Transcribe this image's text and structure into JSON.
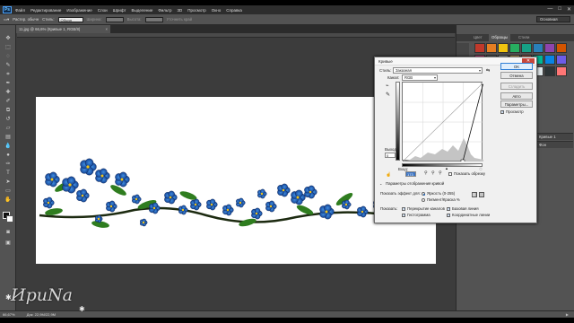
{
  "app": {
    "logo": "Ps",
    "menu": [
      "Файл",
      "Редактирование",
      "Изображение",
      "Слои",
      "Шрифт",
      "Выделение",
      "Фильтр",
      "3D",
      "Просмотр",
      "Окно",
      "Справка"
    ],
    "window_controls": [
      "—",
      "□",
      "✕"
    ]
  },
  "options": {
    "tool_label": "Растер. обычн",
    "mode_label": "Стиль:",
    "mode_value": "Обычн",
    "width_label": "Ширина:",
    "height_label": "Высота:",
    "refine": "Уточнить край",
    "workspace": "Основная"
  },
  "document": {
    "tab_title": "11.jpg @ 66,6% (Кривые 1, RGB/8)",
    "close": "×"
  },
  "status": {
    "zoom": "66,67%",
    "info": "Док: 22,9M/22,9M",
    "right": "▶"
  },
  "panels": {
    "tabs": [
      "Цвет",
      "Образцы",
      "Стили"
    ],
    "active_tab": 1,
    "layers": [
      "Кривые 1",
      "Фон"
    ],
    "swatch_colors": [
      "#c0392b",
      "#e67e22",
      "#f1c40f",
      "#27ae60",
      "#16a085",
      "#2980b9",
      "#8e44ad",
      "#d35400",
      "#e84393",
      "#636e72",
      "#b2bec3",
      "#fdcb6e",
      "#e17055",
      "#00b894",
      "#0984e3",
      "#6c5ce7",
      "#fab1a0",
      "#74b9ff",
      "#a29bfe",
      "#55efc4",
      "#ffeaa7",
      "#dfe6e9",
      "#2d3436",
      "#ff7675"
    ]
  },
  "curves": {
    "title": "Кривые",
    "close": "✕",
    "preset_label": "Стиль:",
    "preset_value": "Заказная",
    "channel_label": "Канал:",
    "channel_value": "RGB",
    "output_label": "Выход:",
    "output_value": "0",
    "input_label": "Вход:",
    "input_value": "173",
    "show_clipping": "Показать обрезку",
    "curve_display": "Параметры отображения кривой",
    "show_amount": "Показать эффект для:",
    "light": "Яркость (0-255)",
    "pigment": "Пигмент/Краска %",
    "show": "Показать:",
    "channel_overlays": "Перекрытие каналов",
    "baseline": "Базовая линия",
    "histogram": "Гистограмма",
    "intersection": "Координатные линии",
    "buttons": {
      "ok": "OK",
      "cancel": "Отмена",
      "smooth": "Сгладить",
      "auto": "Авто",
      "options": "Параметры..."
    },
    "preview": "Просмотр"
  },
  "watermark": {
    "text": "ИриNа",
    "stars": [
      "✱",
      "✱",
      "✱"
    ]
  }
}
